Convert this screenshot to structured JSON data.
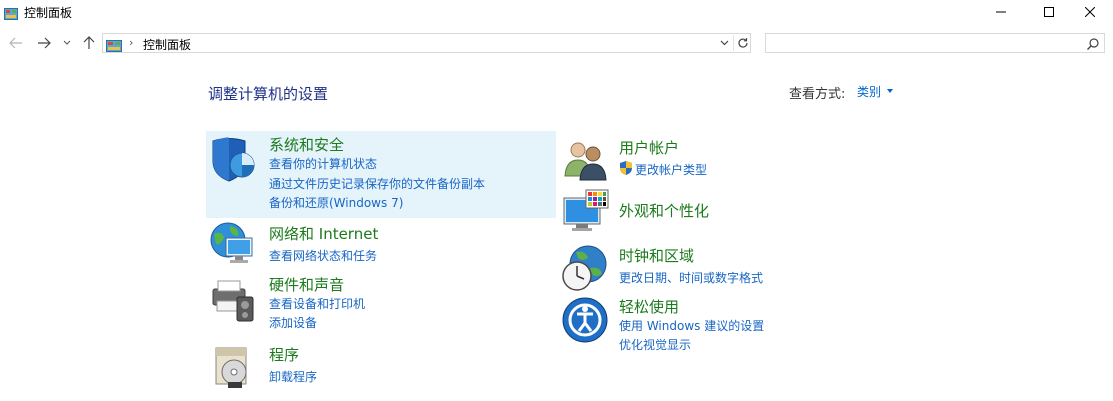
{
  "window": {
    "title": "控制面板"
  },
  "address": {
    "separator": "›",
    "path": "控制面板"
  },
  "search": {
    "placeholder": ""
  },
  "header": {
    "title": "调整计算机的设置",
    "view_by_label": "查看方式:",
    "view_by_value": "类别"
  },
  "categories": {
    "system_security": {
      "title": "系统和安全",
      "links": [
        "查看你的计算机状态",
        "通过文件历史记录保存你的文件备份副本",
        "备份和还原(Windows 7)"
      ]
    },
    "network": {
      "title": "网络和 Internet",
      "links": [
        "查看网络状态和任务"
      ]
    },
    "hardware": {
      "title": "硬件和声音",
      "links": [
        "查看设备和打印机",
        "添加设备"
      ]
    },
    "programs": {
      "title": "程序",
      "links": [
        "卸载程序"
      ]
    },
    "user_accounts": {
      "title": "用户帐户",
      "links": [
        "更改帐户类型"
      ]
    },
    "appearance": {
      "title": "外观和个性化",
      "links": []
    },
    "clock_region": {
      "title": "时钟和区域",
      "links": [
        "更改日期、时间或数字格式"
      ]
    },
    "ease_of_access": {
      "title": "轻松使用",
      "links": [
        "使用 Windows 建议的设置",
        "优化视觉显示"
      ]
    }
  },
  "colors": {
    "accent_link": "#1866c4",
    "category_title": "#1c7a1c",
    "page_title": "#1e3287",
    "highlight": "#e5f3fb"
  },
  "icons": [
    "control-panel-icon",
    "back-arrow-icon",
    "forward-arrow-icon",
    "recent-dropdown-icon",
    "up-arrow-icon",
    "refresh-icon",
    "search-icon",
    "shield-icon",
    "network-globe-icon",
    "printer-icon",
    "programs-disc-icon",
    "users-icon",
    "uac-shield-icon",
    "monitor-palette-icon",
    "clock-globe-icon",
    "ease-of-access-icon",
    "minimize-icon",
    "maximize-icon",
    "close-icon"
  ]
}
